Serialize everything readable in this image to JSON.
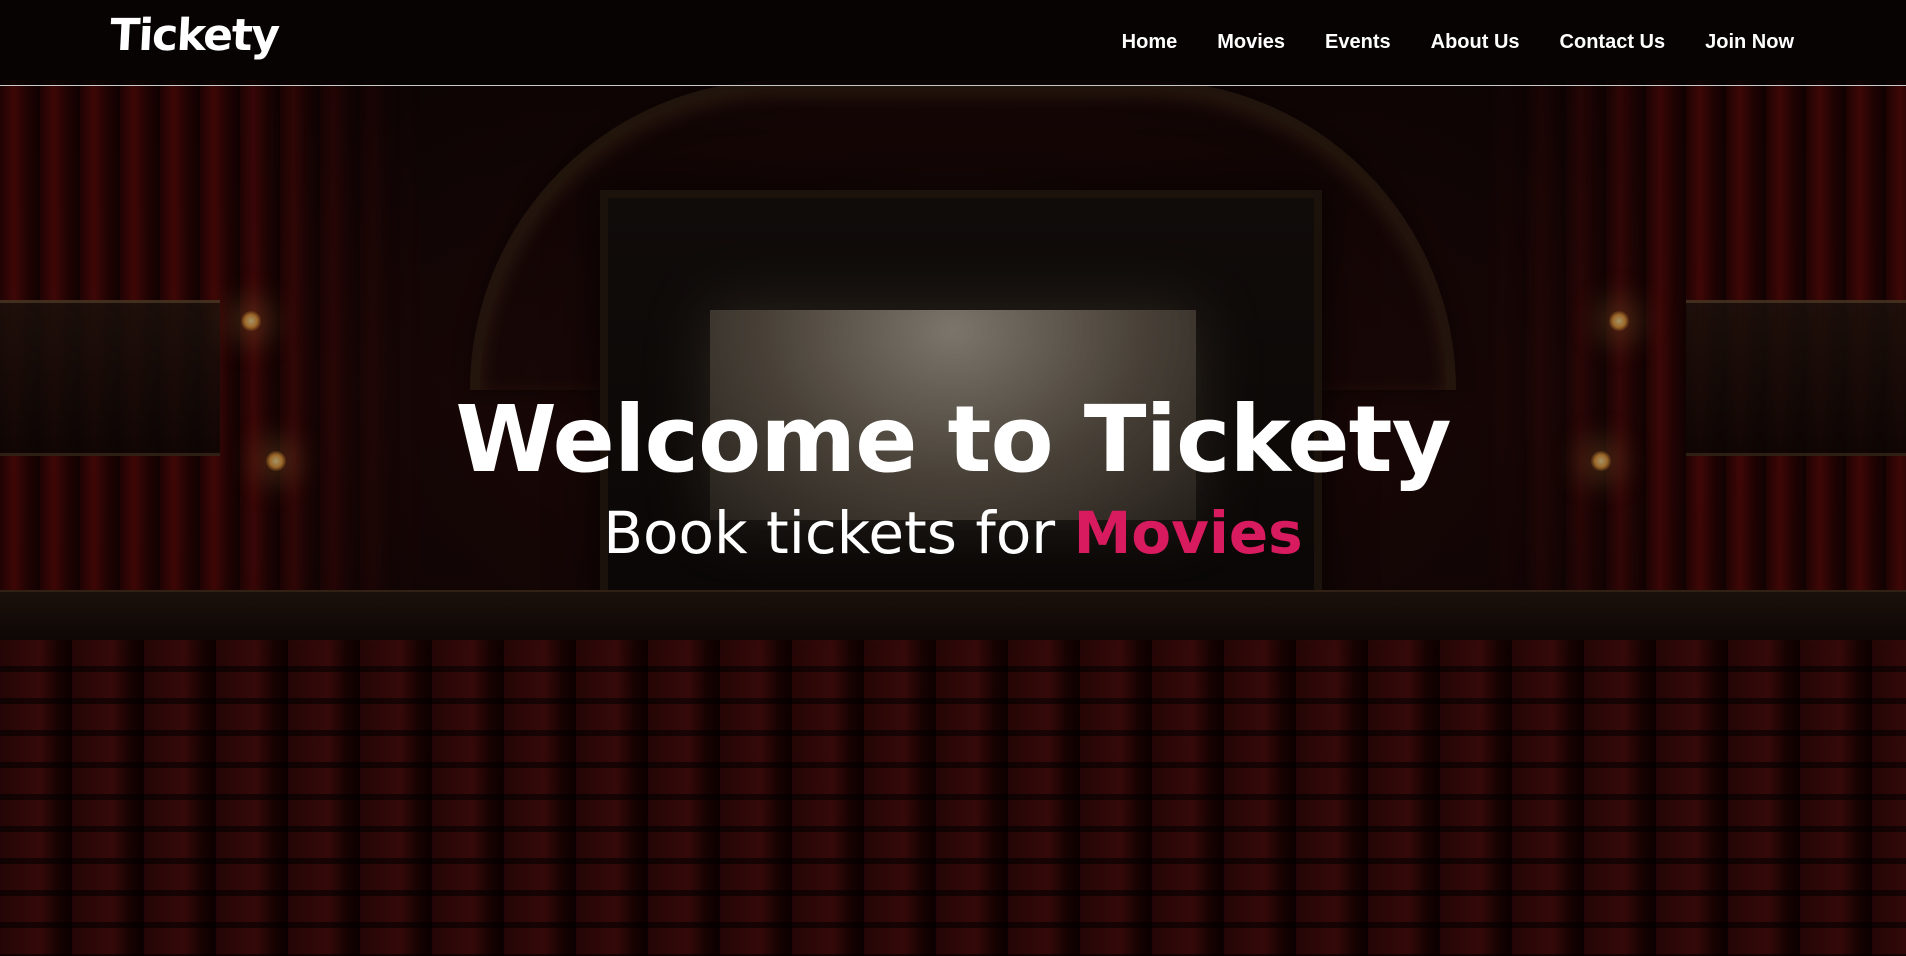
{
  "brand": {
    "logo_text": "Tickety"
  },
  "nav": {
    "items": [
      {
        "label": "Home"
      },
      {
        "label": "Movies"
      },
      {
        "label": "Events"
      },
      {
        "label": "About Us"
      },
      {
        "label": "Contact Us"
      },
      {
        "label": "Join Now"
      }
    ]
  },
  "hero": {
    "title": "Welcome to Tickety",
    "subtitle_prefix": "Book tickets for ",
    "subtitle_highlight": "Movies",
    "background": "theater-auditorium-image"
  },
  "colors": {
    "accent": "#d81b5e",
    "text": "#ffffff",
    "nav_background": "#060404"
  }
}
